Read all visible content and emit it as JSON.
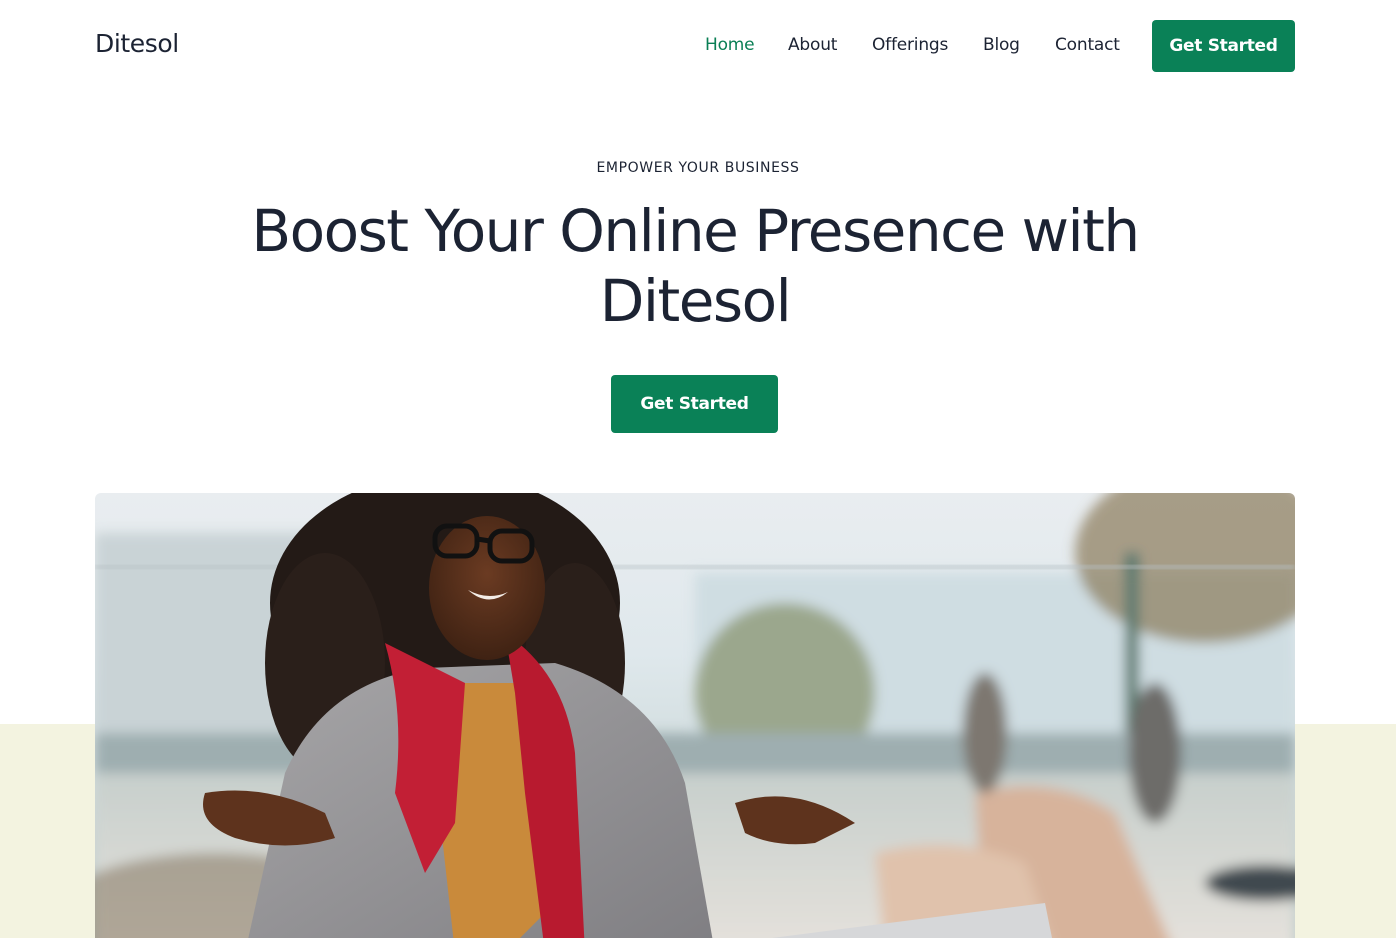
{
  "header": {
    "logo": "Ditesol",
    "nav": [
      {
        "label": "Home",
        "active": true
      },
      {
        "label": "About",
        "active": false
      },
      {
        "label": "Offerings",
        "active": false
      },
      {
        "label": "Blog",
        "active": false
      },
      {
        "label": "Contact",
        "active": false
      }
    ],
    "cta_label": "Get Started"
  },
  "hero": {
    "eyebrow": "EMPOWER YOUR BUSINESS",
    "title": "Boost Your Online Presence with Ditesol",
    "cta_label": "Get Started",
    "image_subject": "woman-with-red-scarf-photo"
  },
  "colors": {
    "accent": "#0a8157",
    "nav_active": "#0a7f55",
    "text": "#1c2333",
    "band": "#f3f3e0",
    "background": "#ffffff"
  }
}
